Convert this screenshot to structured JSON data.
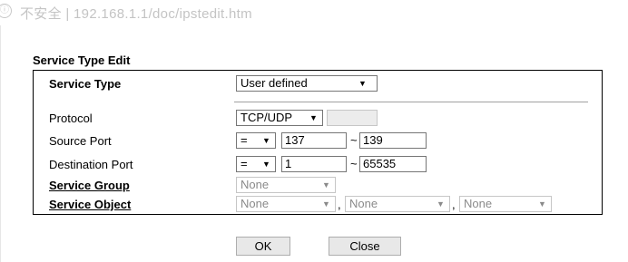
{
  "browser": {
    "url": "不安全 | 192.168.1.1/doc/ipstedit.htm"
  },
  "dialog": {
    "title": "Service Type Edit",
    "service_type": {
      "label": "Service Type",
      "value": "User defined"
    },
    "protocol": {
      "label": "Protocol",
      "value": "TCP/UDP",
      "number": ""
    },
    "source_port": {
      "label": "Source Port",
      "operator": "=",
      "start": "137",
      "end": "139"
    },
    "destination_port": {
      "label": "Destination Port",
      "operator": "=",
      "start": "1",
      "end": "65535"
    },
    "service_group": {
      "label": "Service Group",
      "value": "None"
    },
    "service_object": {
      "label": "Service Object",
      "values": [
        "None",
        "None",
        "None"
      ]
    },
    "range_separator": "~",
    "list_separator": ",",
    "buttons": {
      "ok": "OK",
      "close": "Close"
    }
  },
  "icons": {
    "dropdown_arrow": "▼",
    "info": "ⓘ"
  }
}
